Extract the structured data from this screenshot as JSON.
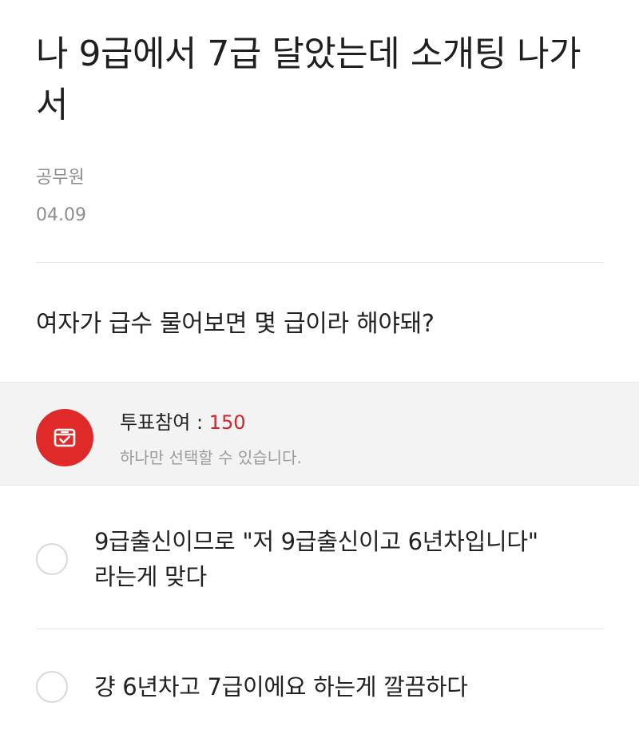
{
  "post": {
    "title": "나 9급에서 7급 달았는데 소개팅 나가서",
    "category": "공무원",
    "date": "04.09",
    "body": "여자가 급수 물어보면 몇 급이라 해야돼?"
  },
  "poll": {
    "participation_label": "투표참여 : ",
    "participation_count": "150",
    "note": "하나만 선택할 수 있습니다.",
    "icon": "ballot-box-icon",
    "accent_color": "#e02a2a",
    "options": [
      {
        "label": "9급출신이므로 \"저 9급출신이고 6년차입니다\" 라는게 맞다",
        "selected": false
      },
      {
        "label": "걍 6년차고 7급이에요 하는게 깔끔하다",
        "selected": false
      }
    ]
  }
}
